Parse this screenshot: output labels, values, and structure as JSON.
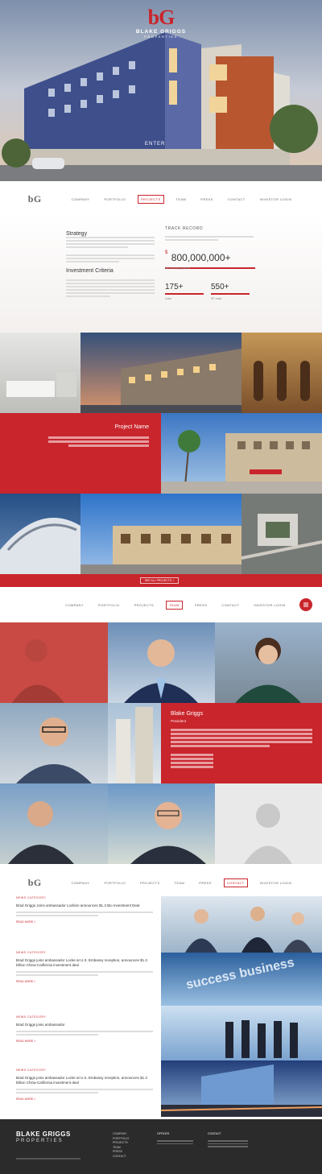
{
  "brand": {
    "mark": "bG",
    "name": "BLAKE GRIGGS",
    "sub": "PROPERTIES"
  },
  "hero": {
    "sign": "ENTER"
  },
  "nav1": [
    "COMPANY",
    "PORTFOLIO",
    "PROJECTS",
    "TEAM",
    "PRESS",
    "CONTACT",
    "INVESTOR LOGIN"
  ],
  "nav2": [
    "COMPANY",
    "PORTFOLIO",
    "PROJECTS",
    "TEAM",
    "PRESS",
    "CONTACT",
    "INVESTOR LOGIN"
  ],
  "nav3": [
    "COMPANY",
    "PORTFOLIO",
    "PROJECTS",
    "TEAM",
    "PRESS",
    "CONTACT",
    "INVESTOR LOGIN"
  ],
  "company": {
    "strategy_title": "Strategy",
    "criteria_title": "Investment Criteria",
    "track_title": "TRACK RECORD",
    "currency": "$",
    "amount": "800,000,000+",
    "amount_label": "NW current pipeline",
    "stat1": "175+",
    "stat1_label": "Units",
    "stat2": "550+",
    "stat2_label": "SF retail"
  },
  "project": {
    "title": "Project Name",
    "button": "SEE ALL PROJECTS  >"
  },
  "team": {
    "name": "Blake Griggs",
    "role": "President"
  },
  "press": {
    "items": [
      {
        "cat": "NEWS CATEGORY",
        "title": "Brad Griggs Joins ambassador Locklon announces $1.3 Bio Investment Deal",
        "more": "READ MORE >"
      },
      {
        "cat": "NEWS CATEGORY",
        "title": "Brad Griggs joins ambassador Locke at U.S. Embassy reception, announces $1.3 billion China-California investment deal",
        "more": "READ MORE >"
      },
      {
        "cat": "NEWS CATEGORY",
        "title": "Brad Griggs joins ambassador",
        "more": "READ MORE >"
      },
      {
        "cat": "NEWS CATEGORY",
        "title": "Brad Griggs joins ambassador Locke at U.S. Embassy reception, announces $1.3 billion China-California investment deal",
        "more": "READ MORE >"
      }
    ],
    "banner_word": "success business"
  },
  "footer": {
    "name": "BLAKE GRIGGS",
    "sub": "PROPERTIES",
    "links": [
      "COMPANY",
      "PORTFOLIO",
      "PROJECTS",
      "TEAM",
      "PRESS",
      "CONTACT"
    ],
    "office_title": "OFFICES",
    "contact_title": "CONTACT"
  }
}
